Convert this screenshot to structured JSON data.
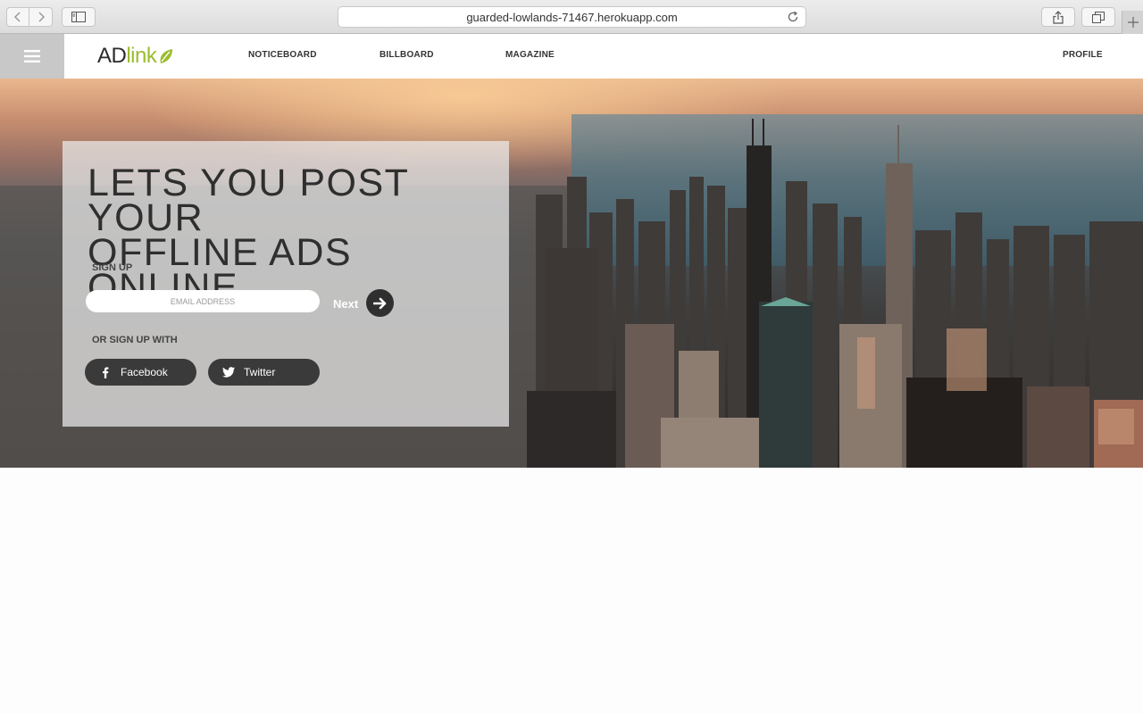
{
  "browser": {
    "url": "guarded-lowlands-71467.herokuapp.com"
  },
  "header": {
    "logo": {
      "part1": "AD",
      "part2": "link"
    },
    "nav": [
      "NOTICEBOARD",
      "BILLBOARD",
      "MAGAZINE"
    ],
    "profile": "PROFILE"
  },
  "hero": {
    "headline_line1": "LETS YOU POST YOUR",
    "headline_line2": "OFFLINE ADS ONLINE",
    "signup_label": "SIGN UP",
    "email_placeholder": "EMAIL ADDRESS",
    "next_label": "Next",
    "or_signup_label": "OR SIGN UP WITH",
    "facebook_label": "Facebook",
    "twitter_label": "Twitter"
  },
  "colors": {
    "accent_green": "#9bbd2f",
    "dark_button": "#3a3a3a",
    "menu_bg": "#c8c8c8"
  },
  "icons": [
    "back-icon",
    "forward-icon",
    "sidebar-icon",
    "reload-icon",
    "share-icon",
    "tabs-icon",
    "plus-icon",
    "hamburger-icon",
    "leaf-icon",
    "arrow-right-icon",
    "facebook-icon",
    "twitter-icon"
  ]
}
